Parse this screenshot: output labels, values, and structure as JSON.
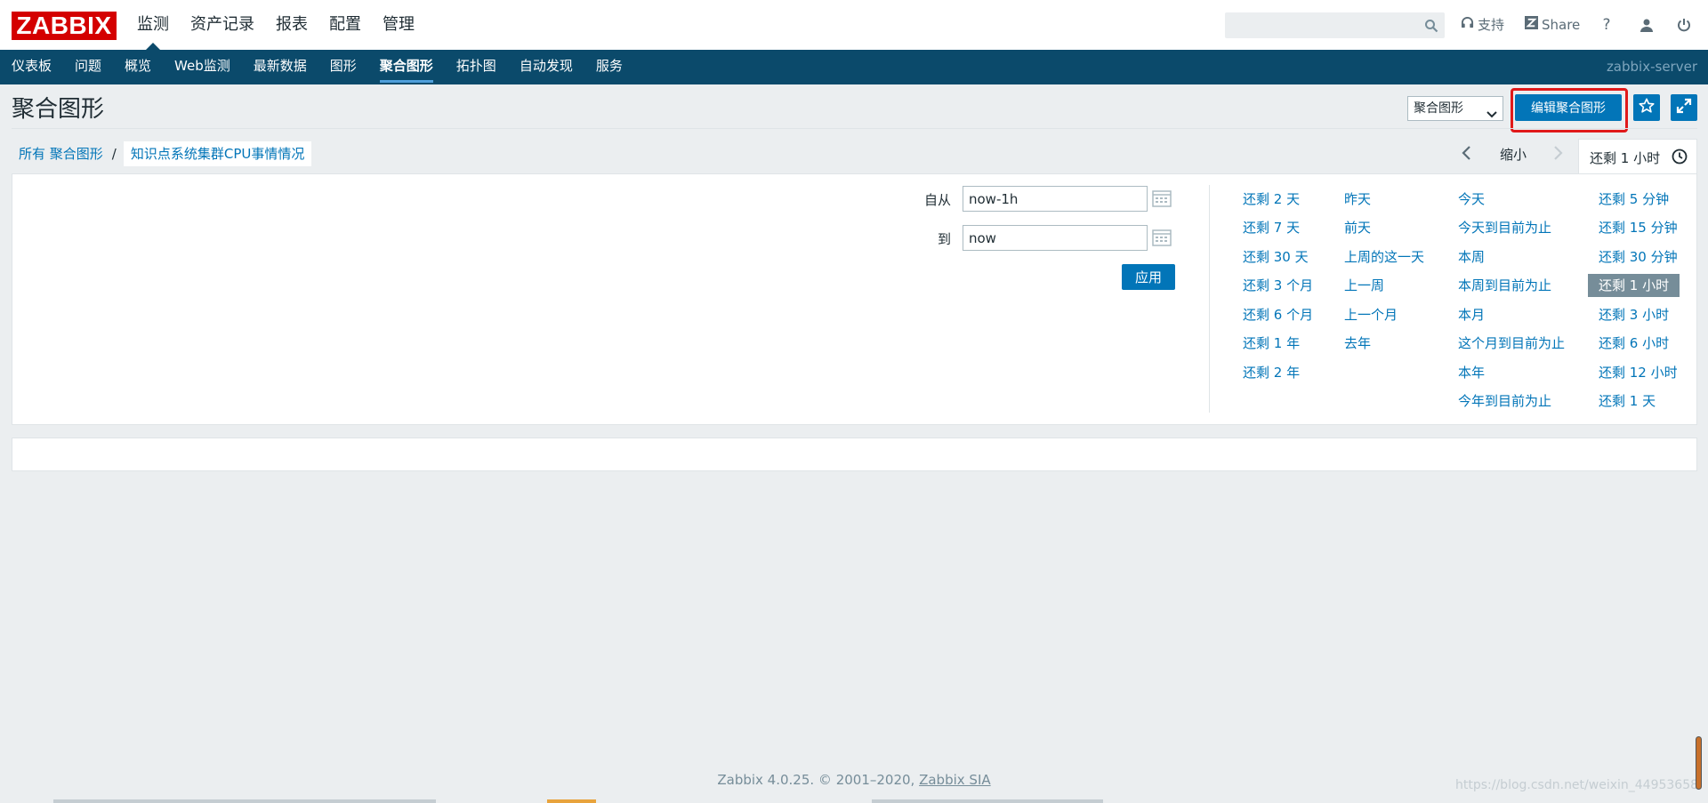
{
  "header": {
    "logo": "ZABBIX",
    "tabs": [
      {
        "label": "监测",
        "active": true
      },
      {
        "label": "资产记录",
        "active": false
      },
      {
        "label": "报表",
        "active": false
      },
      {
        "label": "配置",
        "active": false
      },
      {
        "label": "管理",
        "active": false
      }
    ],
    "search_value": "",
    "support_label": "支持",
    "share_label": "Share",
    "help_label": "?"
  },
  "subnav": {
    "items": [
      "仪表板",
      "问题",
      "概览",
      "Web监测",
      "最新数据",
      "图形",
      "聚合图形",
      "拓扑图",
      "自动发现",
      "服务"
    ],
    "active": "聚合图形",
    "server": "zabbix-server"
  },
  "page": {
    "title": "聚合图形",
    "select_value": "聚合图形",
    "edit_button": "编辑聚合图形"
  },
  "breadcrumb": {
    "all_label": "所有 聚合图形",
    "separator": "/",
    "current": "知识点系统集群CPU事情情况"
  },
  "time": {
    "zoom_out": "缩小",
    "tab_label": "还剩 1 小时"
  },
  "filter": {
    "from_label": "自从",
    "from_value": "now-1h",
    "to_label": "到",
    "to_value": "now",
    "apply": "应用"
  },
  "quick_ranges": {
    "col1": [
      "还剩 2 天",
      "还剩 7 天",
      "还剩 30 天",
      "还剩 3 个月",
      "还剩 6 个月",
      "还剩 1 年",
      "还剩 2 年"
    ],
    "col2": [
      "昨天",
      "前天",
      "上周的这一天",
      "上一周",
      "上一个月",
      "去年"
    ],
    "col3": [
      "今天",
      "今天到目前为止",
      "本周",
      "本周到目前为止",
      "本月",
      "这个月到目前为止",
      "本年",
      "今年到目前为止"
    ],
    "col4": [
      "还剩 5 分钟",
      "还剩 15 分钟",
      "还剩 30 分钟",
      "还剩 1 小时",
      "还剩 3 小时",
      "还剩 6 小时",
      "还剩 12 小时",
      "还剩 1 天"
    ],
    "selected": "还剩 1 小时"
  },
  "footer": {
    "text": "Zabbix 4.0.25. © 2001–2020,",
    "link": "Zabbix SIA"
  },
  "watermark": "https://blog.csdn.net/weixin_44953658",
  "colors": {
    "brand_red": "#d40000",
    "nav_blue": "#0b4a6b",
    "accent_blue": "#0275b8",
    "highlight_red": "#e0191a"
  }
}
